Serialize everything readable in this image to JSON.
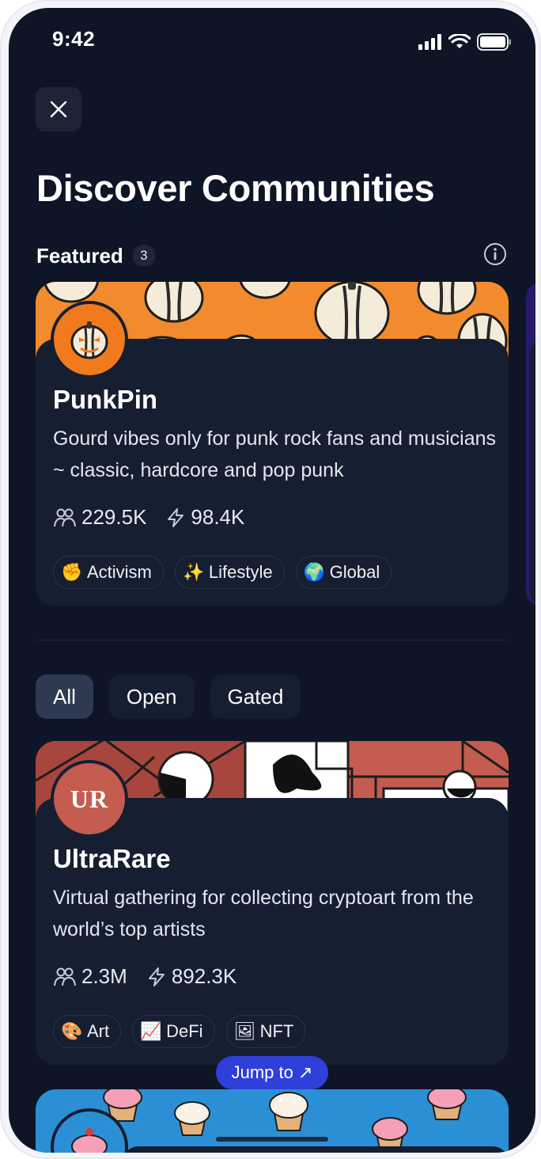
{
  "status_bar": {
    "time": "9:42"
  },
  "header": {
    "title": "Discover Communities"
  },
  "featured": {
    "label": "Featured",
    "count": "3",
    "card": {
      "name": "PunkPin",
      "description": "Gourd vibes only for punk rock fans and musicians ~ classic, hardcore and pop punk",
      "members": "229.5K",
      "activity": "98.4K",
      "tags": [
        {
          "emoji": "✊",
          "label": "Activism"
        },
        {
          "emoji": "✨",
          "label": "Lifestyle"
        },
        {
          "emoji": "🌍",
          "label": "Global"
        }
      ]
    }
  },
  "filters": {
    "items": [
      "All",
      "Open",
      "Gated"
    ],
    "selected": "All"
  },
  "communities": [
    {
      "name": "UltraRare",
      "avatar_text": "UR",
      "description": "Virtual gathering for collecting cryptoart from the world’s top artists",
      "members": "2.3M",
      "activity": "892.3K",
      "tags": [
        {
          "emoji": "🎨",
          "label": "Art"
        },
        {
          "emoji": "📈",
          "label": "DeFi"
        },
        {
          "emoji": "🖼",
          "label": "NFT"
        }
      ]
    }
  ],
  "jump_button": {
    "label": "Jump to ↗"
  },
  "colors": {
    "background": "#0e1526",
    "card": "#161e31",
    "chip_active": "#2e3a52",
    "jump_button": "#2f3fd9",
    "punkpin_orange": "#f28a2e",
    "ultrarare_red": "#c45c4f",
    "cupcake_blue": "#2b8fd6"
  },
  "icons": [
    "close-icon",
    "info-icon",
    "members-icon",
    "lightning-icon",
    "signal-icon",
    "wifi-icon",
    "battery-icon"
  ]
}
